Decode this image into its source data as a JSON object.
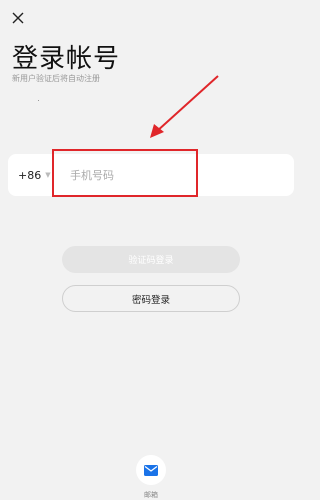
{
  "header": {
    "close_icon": "close-icon",
    "title": "登录帐号",
    "subtitle": "新用户验证后将自动注册"
  },
  "phone": {
    "country_code": "+86",
    "placeholder": "手机号码",
    "value": ""
  },
  "buttons": {
    "sms_login": "验证码登录",
    "password_login": "密码登录"
  },
  "alt_login": {
    "icon": "mail-icon",
    "label": "邮箱"
  },
  "colors": {
    "background": "#f2f2f2",
    "annotation_red": "#e0262a",
    "accent_blue": "#1a73e8"
  }
}
